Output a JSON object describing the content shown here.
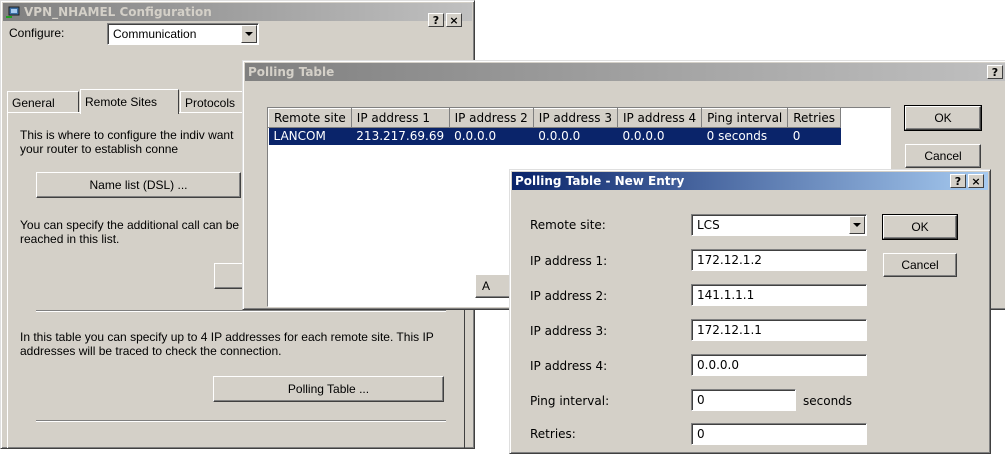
{
  "config_dialog": {
    "title": "VPN_NHAMEL Configuration",
    "configure_label": "Configure:",
    "configure_value": "Communication",
    "tabs": [
      "General",
      "Remote Sites",
      "Protocols"
    ],
    "desc1": "This is where to configure the indiv want your router to establish conne",
    "name_list_button": "Name list (DSL) ...",
    "desc2": "You can specify the additional call can be reached in this list.",
    "desc3": "In this table you can specify up to 4 IP addresses for each remote site. This IP addresses will be traced to check the connection.",
    "polling_table_button": "Polling Table ..."
  },
  "polling_dialog": {
    "title": "Polling Table",
    "columns": [
      "Remote site",
      "IP address 1",
      "IP address 2",
      "IP address 3",
      "IP address 4",
      "Ping interval",
      "Retries"
    ],
    "rows": [
      [
        "LANCOM",
        "213.217.69.69",
        "0.0.0.0",
        "0.0.0.0",
        "0.0.0.0",
        "0 seconds",
        "0"
      ]
    ],
    "ok_label": "OK",
    "cancel_label": "Cancel",
    "add_partial": "A"
  },
  "new_entry_dialog": {
    "title": "Polling Table - New Entry",
    "remote_site_label": "Remote site:",
    "remote_site_value": "LCS",
    "ip1_label": "IP address 1:",
    "ip1_value": "172.12.1.2",
    "ip2_label": "IP address 2:",
    "ip2_value": "141.1.1.1",
    "ip3_label": "IP address 3:",
    "ip3_value": "172.12.1.1",
    "ip4_label": "IP address 4:",
    "ip4_value": "0.0.0.0",
    "ping_label": "Ping interval:",
    "ping_value": "0",
    "ping_unit": "seconds",
    "retries_label": "Retries:",
    "retries_value": "0",
    "ok_label": "OK",
    "cancel_label": "Cancel"
  },
  "title_buttons": {
    "help": "?",
    "close": "×"
  },
  "colors": {
    "face": "#d4d0c8",
    "active_title": "#0a246a",
    "inactive_title": "#808080",
    "selection": "#0a246a"
  }
}
